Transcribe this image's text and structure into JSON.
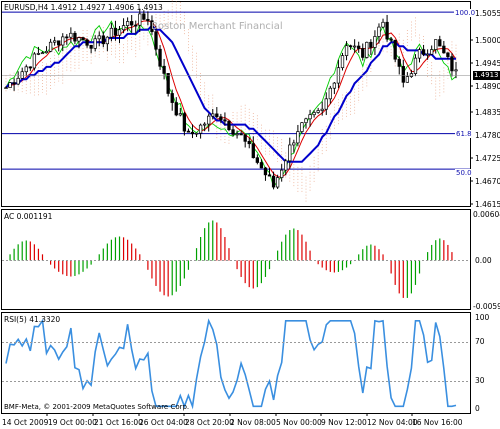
{
  "price_panel": {
    "header": "EURUSD,H4  1.4912 1.4927 1.4906 1.4913",
    "watermark": "Boston Merchant Financial",
    "current_price": "1.4913",
    "fib_levels": [
      {
        "label": "100.0",
        "price": 1.5063
      },
      {
        "label": "61.8",
        "price": 1.4768
      },
      {
        "label": "50.0",
        "price": 1.4682
      }
    ],
    "axis_ticks": [
      "1.5055",
      "1.5000",
      "1.4945",
      "1.4890",
      "1.4835",
      "1.4780",
      "1.4725",
      "1.4670",
      "1.4615"
    ],
    "axis_range": [
      1.4595,
      1.5085
    ],
    "colors": {
      "up_candle": "#ffffff",
      "down_candle": "#000000",
      "kijun": "#0000cc",
      "tenkan": "#dd0000",
      "chikou": "#00cc00",
      "fib_line": "#0000aa",
      "kumo": "#e8a080"
    }
  },
  "ac_panel": {
    "header": "AC 0.001191",
    "axis_ticks": [
      "0.006046",
      "0.00",
      "-0.00599"
    ],
    "range": [
      -0.00599,
      0.006046
    ],
    "colors": {
      "up": "#00a000",
      "down": "#dd0000"
    }
  },
  "rsi_panel": {
    "header": "RSI(5) 41.3320",
    "axis_ticks": [
      "100",
      "70",
      "30",
      "0"
    ],
    "color": "#3a8fe0"
  },
  "footer": {
    "copyright": "BMF-Meta, © 2001-2009 MetaQuotes Software Corp."
  },
  "time_axis": [
    "14 Oct 2009",
    "19 Oct 00:00",
    "21 Oct 16:00",
    "26 Oct 04:00",
    "28 Oct 20:00",
    "2 Nov 08:00",
    "5 Nov 00:00",
    "9 Nov 12:00",
    "12 Nov 04:00",
    "16 Nov 16:00"
  ]
}
